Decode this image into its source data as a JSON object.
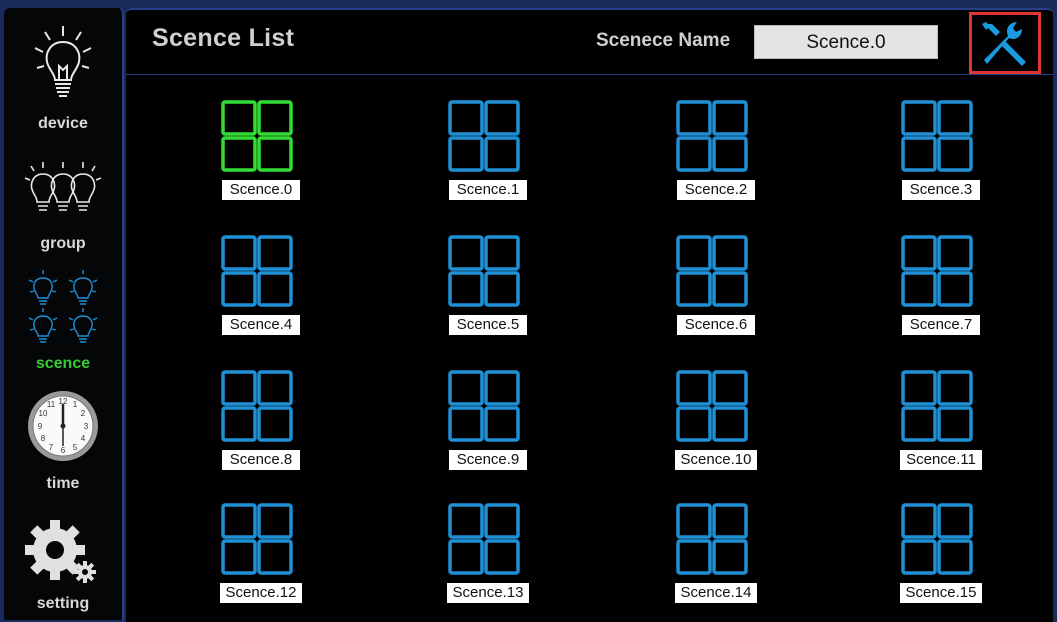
{
  "header": {
    "title": "Scence List",
    "scene_name_label": "Scenece Name",
    "scene_name_value": "Scence.0",
    "tool_icon": "wrench-screwdriver-icon"
  },
  "sidebar": {
    "items": [
      {
        "label": "device",
        "icon": "bulb-icon",
        "active": false
      },
      {
        "label": "group",
        "icon": "bulbs-group-icon",
        "active": false
      },
      {
        "label": "scence",
        "icon": "scene-bulbs-icon",
        "active": true
      },
      {
        "label": "time",
        "icon": "clock-icon",
        "active": false
      },
      {
        "label": "setting",
        "icon": "gear-icon",
        "active": false
      }
    ]
  },
  "scenes": [
    {
      "label": "Scence.0",
      "selected": true
    },
    {
      "label": "Scence.1",
      "selected": false
    },
    {
      "label": "Scence.2",
      "selected": false
    },
    {
      "label": "Scence.3",
      "selected": false
    },
    {
      "label": "Scence.4",
      "selected": false
    },
    {
      "label": "Scence.5",
      "selected": false
    },
    {
      "label": "Scence.6",
      "selected": false
    },
    {
      "label": "Scence.7",
      "selected": false
    },
    {
      "label": "Scence.8",
      "selected": false
    },
    {
      "label": "Scence.9",
      "selected": false
    },
    {
      "label": "Scence.10",
      "selected": false
    },
    {
      "label": "Scence.11",
      "selected": false
    },
    {
      "label": "Scence.12",
      "selected": false
    },
    {
      "label": "Scence.13",
      "selected": false
    },
    {
      "label": "Scence.14",
      "selected": false
    },
    {
      "label": "Scence.15",
      "selected": false
    }
  ],
  "colors": {
    "selected": "#33dd33",
    "unselected": "#1f8fd6",
    "active_label": "#33cc33",
    "tool_icon": "#1a9be0",
    "tool_border": "#e03535"
  }
}
